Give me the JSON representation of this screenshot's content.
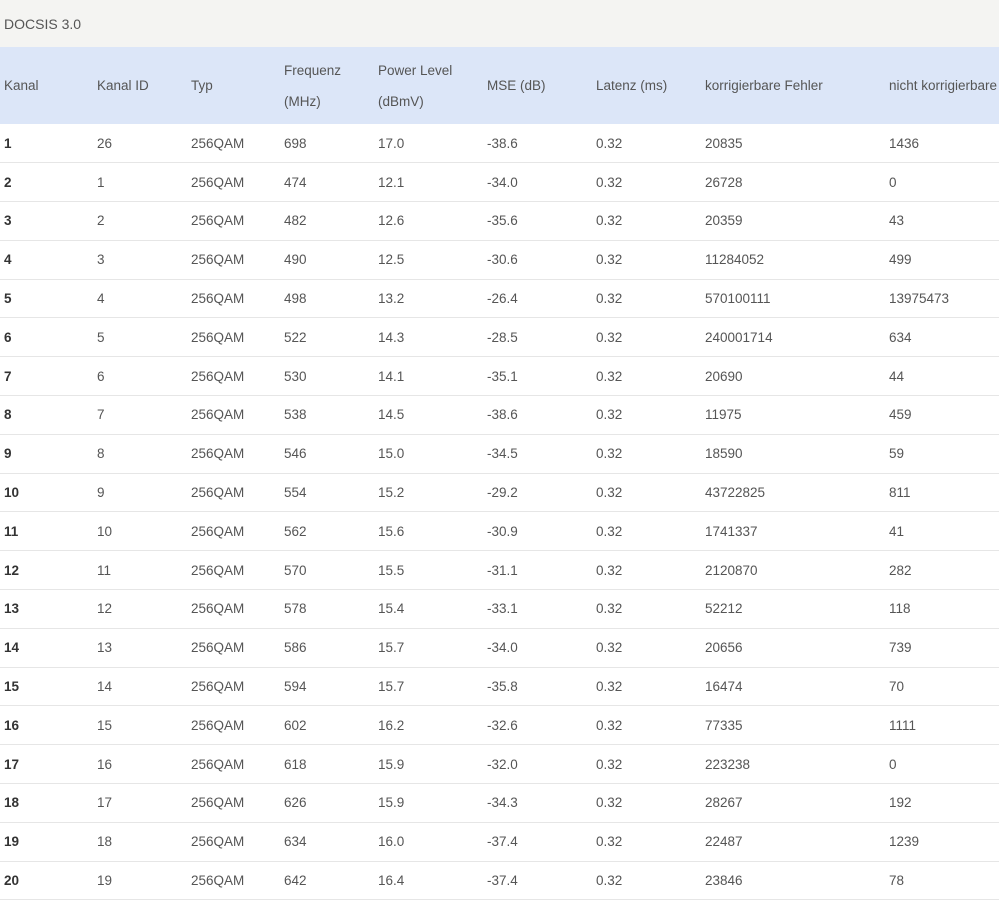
{
  "section": {
    "title": "DOCSIS 3.0"
  },
  "table": {
    "headers": [
      {
        "line1": "Kanal",
        "line2": ""
      },
      {
        "line1": "Kanal ID",
        "line2": ""
      },
      {
        "line1": "Typ",
        "line2": ""
      },
      {
        "line1": "Frequenz",
        "line2": "(MHz)"
      },
      {
        "line1": "Power Level",
        "line2": "(dBmV)"
      },
      {
        "line1": "MSE (dB)",
        "line2": ""
      },
      {
        "line1": "Latenz (ms)",
        "line2": ""
      },
      {
        "line1": "korrigierbare Fehler",
        "line2": ""
      },
      {
        "line1": "nicht korrigierbare",
        "line2": ""
      }
    ],
    "rows": [
      [
        "1",
        "26",
        "256QAM",
        "698",
        "17.0",
        "-38.6",
        "0.32",
        "20835",
        "1436"
      ],
      [
        "2",
        "1",
        "256QAM",
        "474",
        "12.1",
        "-34.0",
        "0.32",
        "26728",
        "0"
      ],
      [
        "3",
        "2",
        "256QAM",
        "482",
        "12.6",
        "-35.6",
        "0.32",
        "20359",
        "43"
      ],
      [
        "4",
        "3",
        "256QAM",
        "490",
        "12.5",
        "-30.6",
        "0.32",
        "11284052",
        "499"
      ],
      [
        "5",
        "4",
        "256QAM",
        "498",
        "13.2",
        "-26.4",
        "0.32",
        "570100111",
        "13975473"
      ],
      [
        "6",
        "5",
        "256QAM",
        "522",
        "14.3",
        "-28.5",
        "0.32",
        "240001714",
        "634"
      ],
      [
        "7",
        "6",
        "256QAM",
        "530",
        "14.1",
        "-35.1",
        "0.32",
        "20690",
        "44"
      ],
      [
        "8",
        "7",
        "256QAM",
        "538",
        "14.5",
        "-38.6",
        "0.32",
        "11975",
        "459"
      ],
      [
        "9",
        "8",
        "256QAM",
        "546",
        "15.0",
        "-34.5",
        "0.32",
        "18590",
        "59"
      ],
      [
        "10",
        "9",
        "256QAM",
        "554",
        "15.2",
        "-29.2",
        "0.32",
        "43722825",
        "811"
      ],
      [
        "11",
        "10",
        "256QAM",
        "562",
        "15.6",
        "-30.9",
        "0.32",
        "1741337",
        "41"
      ],
      [
        "12",
        "11",
        "256QAM",
        "570",
        "15.5",
        "-31.1",
        "0.32",
        "2120870",
        "282"
      ],
      [
        "13",
        "12",
        "256QAM",
        "578",
        "15.4",
        "-33.1",
        "0.32",
        "52212",
        "118"
      ],
      [
        "14",
        "13",
        "256QAM",
        "586",
        "15.7",
        "-34.0",
        "0.32",
        "20656",
        "739"
      ],
      [
        "15",
        "14",
        "256QAM",
        "594",
        "15.7",
        "-35.8",
        "0.32",
        "16474",
        "70"
      ],
      [
        "16",
        "15",
        "256QAM",
        "602",
        "16.2",
        "-32.6",
        "0.32",
        "77335",
        "1111"
      ],
      [
        "17",
        "16",
        "256QAM",
        "618",
        "15.9",
        "-32.0",
        "0.32",
        "223238",
        "0"
      ],
      [
        "18",
        "17",
        "256QAM",
        "626",
        "15.9",
        "-34.3",
        "0.32",
        "28267",
        "192"
      ],
      [
        "19",
        "18",
        "256QAM",
        "634",
        "16.0",
        "-37.4",
        "0.32",
        "22487",
        "1239"
      ],
      [
        "20",
        "19",
        "256QAM",
        "642",
        "16.4",
        "-37.4",
        "0.32",
        "23846",
        "78"
      ]
    ]
  }
}
